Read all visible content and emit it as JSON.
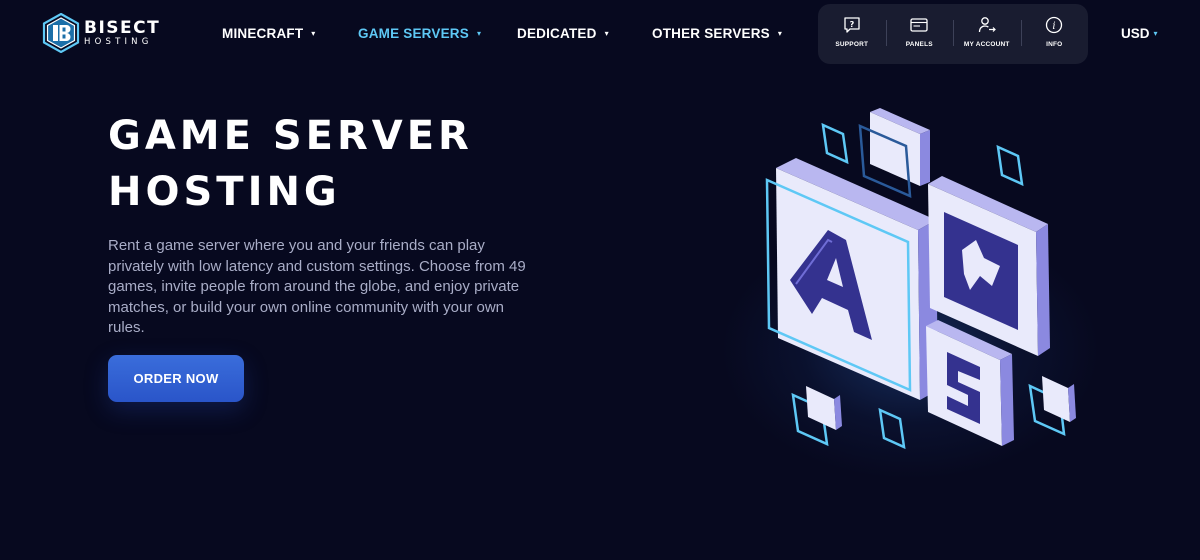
{
  "brand": {
    "name_top": "BISECT",
    "name_bottom": "HOSTING"
  },
  "nav": {
    "items": [
      {
        "label": "MINECRAFT",
        "active": false
      },
      {
        "label": "GAME SERVERS",
        "active": true
      },
      {
        "label": "DEDICATED",
        "active": false
      },
      {
        "label": "OTHER SERVERS",
        "active": false
      }
    ],
    "caret": "▾"
  },
  "panel": {
    "buttons": [
      {
        "label": "SUPPORT",
        "icon": "question-bubble-icon"
      },
      {
        "label": "PANELS",
        "icon": "window-panel-icon"
      },
      {
        "label": "MY ACCOUNT",
        "icon": "user-exit-icon"
      },
      {
        "label": "INFO",
        "icon": "info-icon"
      }
    ]
  },
  "currency": {
    "label": "USD",
    "caret": "▾"
  },
  "hero": {
    "title_line1": "GAME SERVER",
    "title_line2": "HOSTING",
    "description": "Rent a game server where you and your friends can play privately with low latency and custom settings. Choose from 49 games, invite people from around the globe, and enjoy private matches, or build your own online community with your own rules.",
    "cta_label": "ORDER NOW"
  },
  "colors": {
    "background": "#07091f",
    "accent_cyan": "#5ec8f5",
    "button_blue": "#2f5fd3",
    "panel_bg": "#191c30",
    "tile_face": "#e9eafb",
    "tile_side": "#8b89e0",
    "glyph": "#34328f"
  }
}
